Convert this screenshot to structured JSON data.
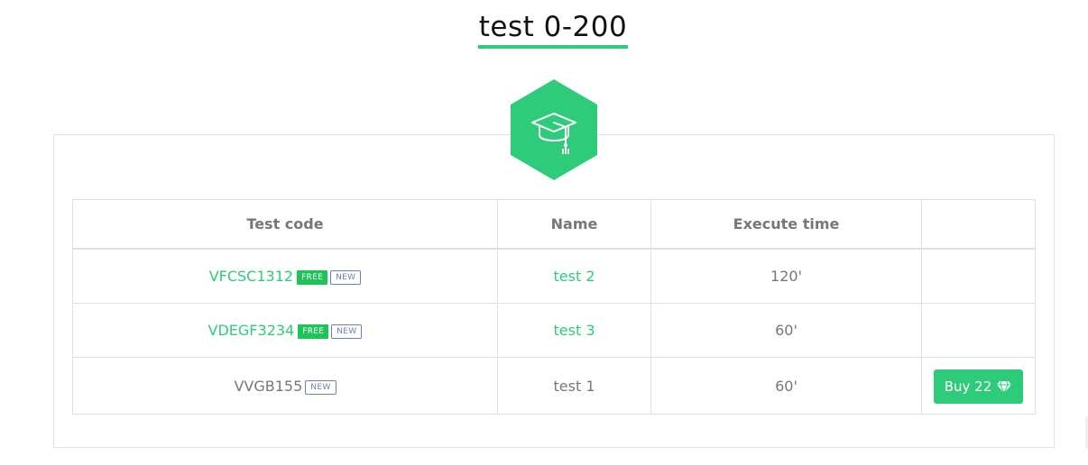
{
  "page": {
    "title": "test 0-200",
    "accent_color": "#2ecc7a"
  },
  "header_icon": "graduation-cap-icon",
  "table": {
    "headers": [
      "Test code",
      "Name",
      "Execute time",
      ""
    ],
    "rows": [
      {
        "code": "VFCSC1312",
        "free": "FREE",
        "new": "NEW",
        "name": "test 2",
        "time": "120'"
      },
      {
        "code": "VDEGF3234",
        "free": "FREE",
        "new": "NEW",
        "name": "test 3",
        "time": "60'"
      },
      {
        "code": "VVGB155",
        "new": "NEW",
        "name": "test 1",
        "time": "60'",
        "buy_label": "Buy 22",
        "buy_icon": "diamond-icon"
      }
    ]
  }
}
